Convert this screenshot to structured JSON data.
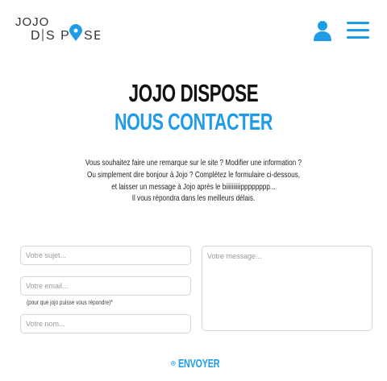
{
  "header": {
    "logo": {
      "line1": "JOJO",
      "line2": "DISPOSE",
      "icon": "map-pin-icon"
    },
    "user_icon": "user-icon",
    "menu_icon": "hamburger-menu-icon"
  },
  "colors": {
    "accent": "#1f9ce8",
    "title": "#111111",
    "border": "#d6d6d6"
  },
  "brand_title": "JOJO DISPOSE",
  "page_title": "NOUS CONTACTER",
  "intro": {
    "lines": [
      "Vous souhaitez faire une remarque sur le site ? Modifier une information ?",
      "Ou simplement dire bonjour à Jojo ? Complétez le formulaire ci-dessous,",
      "et laisser un message à Jojo après le biiiiiiiiiipppppppp...",
      "Il vous répondra dans les meilleurs délais."
    ]
  },
  "form": {
    "subject_placeholder": "Votre sujet...",
    "email_placeholder": "Votre email...",
    "email_hint": "(pour que jojo puisse vous répondre)*",
    "name_placeholder": "Votre nom...",
    "message_placeholder": "Votre message...",
    "submit_label": "ENVOYER",
    "submit_icon": "arrow-circle-right-icon"
  }
}
